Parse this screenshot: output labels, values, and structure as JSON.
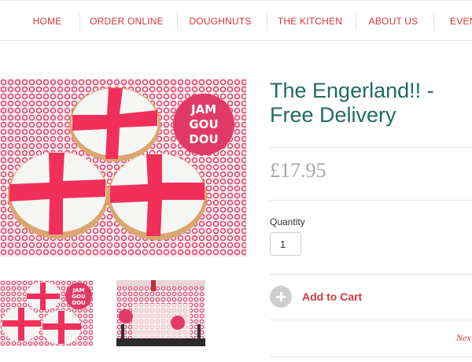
{
  "nav": {
    "items": [
      "HOME",
      "ORDER ONLINE",
      "DOUGHNUTS",
      "THE KITCHEN",
      "ABOUT US",
      "EVEN"
    ]
  },
  "product": {
    "title": "The Engerland!! - Free Delivery",
    "price": "£17.95",
    "quantity_label": "Quantity",
    "quantity_value": "1",
    "add_to_cart": "Add to Cart",
    "next_link": "Nex"
  },
  "logo": {
    "lines": [
      "JAM",
      "GOU",
      "DOU"
    ]
  },
  "colors": {
    "accent": "#d2363c",
    "title": "#1f6b61",
    "price": "#a8a8a8",
    "cross": "#f0305b",
    "logo_bg": "#e23a66"
  }
}
